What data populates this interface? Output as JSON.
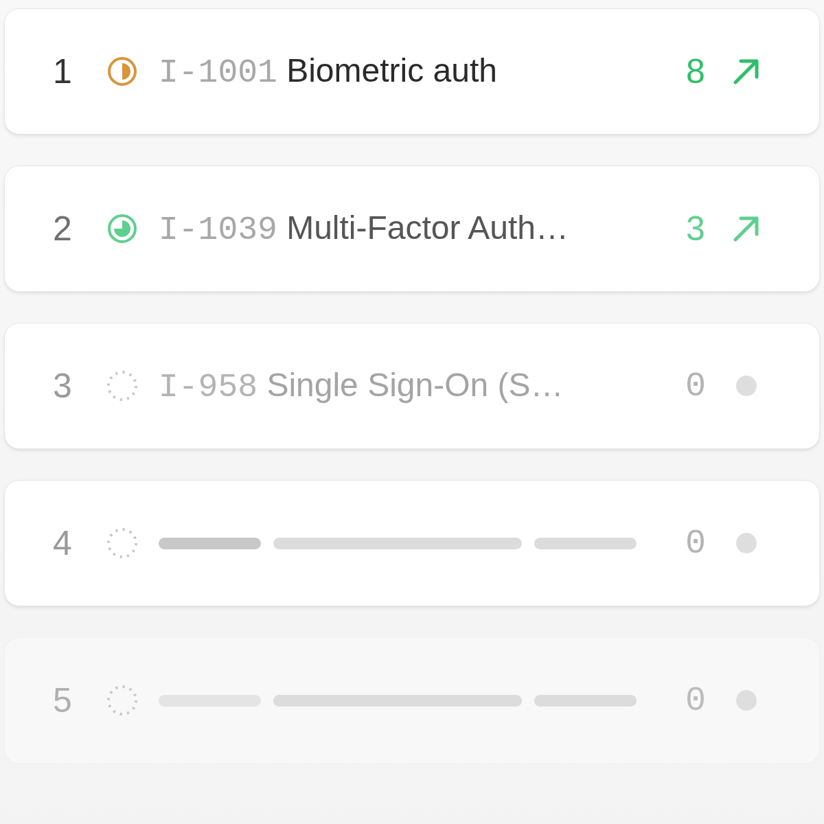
{
  "rows": [
    {
      "kind": "item",
      "rank": "1",
      "status": {
        "kind": "half",
        "color": "#d9953a"
      },
      "id": "I-1001",
      "title": "Biometric auth",
      "count": "8",
      "trend": {
        "kind": "up",
        "color": "#2fbf6a"
      }
    },
    {
      "kind": "item",
      "rank": "2",
      "status": {
        "kind": "three-quarter",
        "color": "#5fcf8f"
      },
      "id": "I-1039",
      "title": "Multi-Factor Auth…",
      "count": "3",
      "trend": {
        "kind": "up",
        "color": "#5fcf8f"
      }
    },
    {
      "kind": "item",
      "rank": "3",
      "status": {
        "kind": "dashed",
        "color": "#c8c8c8"
      },
      "id": "I-958",
      "title": "Single Sign-On (S…",
      "count": "0",
      "trend": {
        "kind": "flat",
        "color": "#dedede"
      }
    },
    {
      "kind": "loading",
      "rank": "4",
      "status": {
        "kind": "dashed",
        "color": "#c8c8c8"
      },
      "count": "0",
      "trend": {
        "kind": "flat",
        "color": "#dedede"
      }
    },
    {
      "kind": "loading",
      "rank": "5",
      "status": {
        "kind": "dashed",
        "color": "#c8c8c8"
      },
      "count": "0",
      "trend": {
        "kind": "flat",
        "color": "#dedede"
      }
    }
  ]
}
